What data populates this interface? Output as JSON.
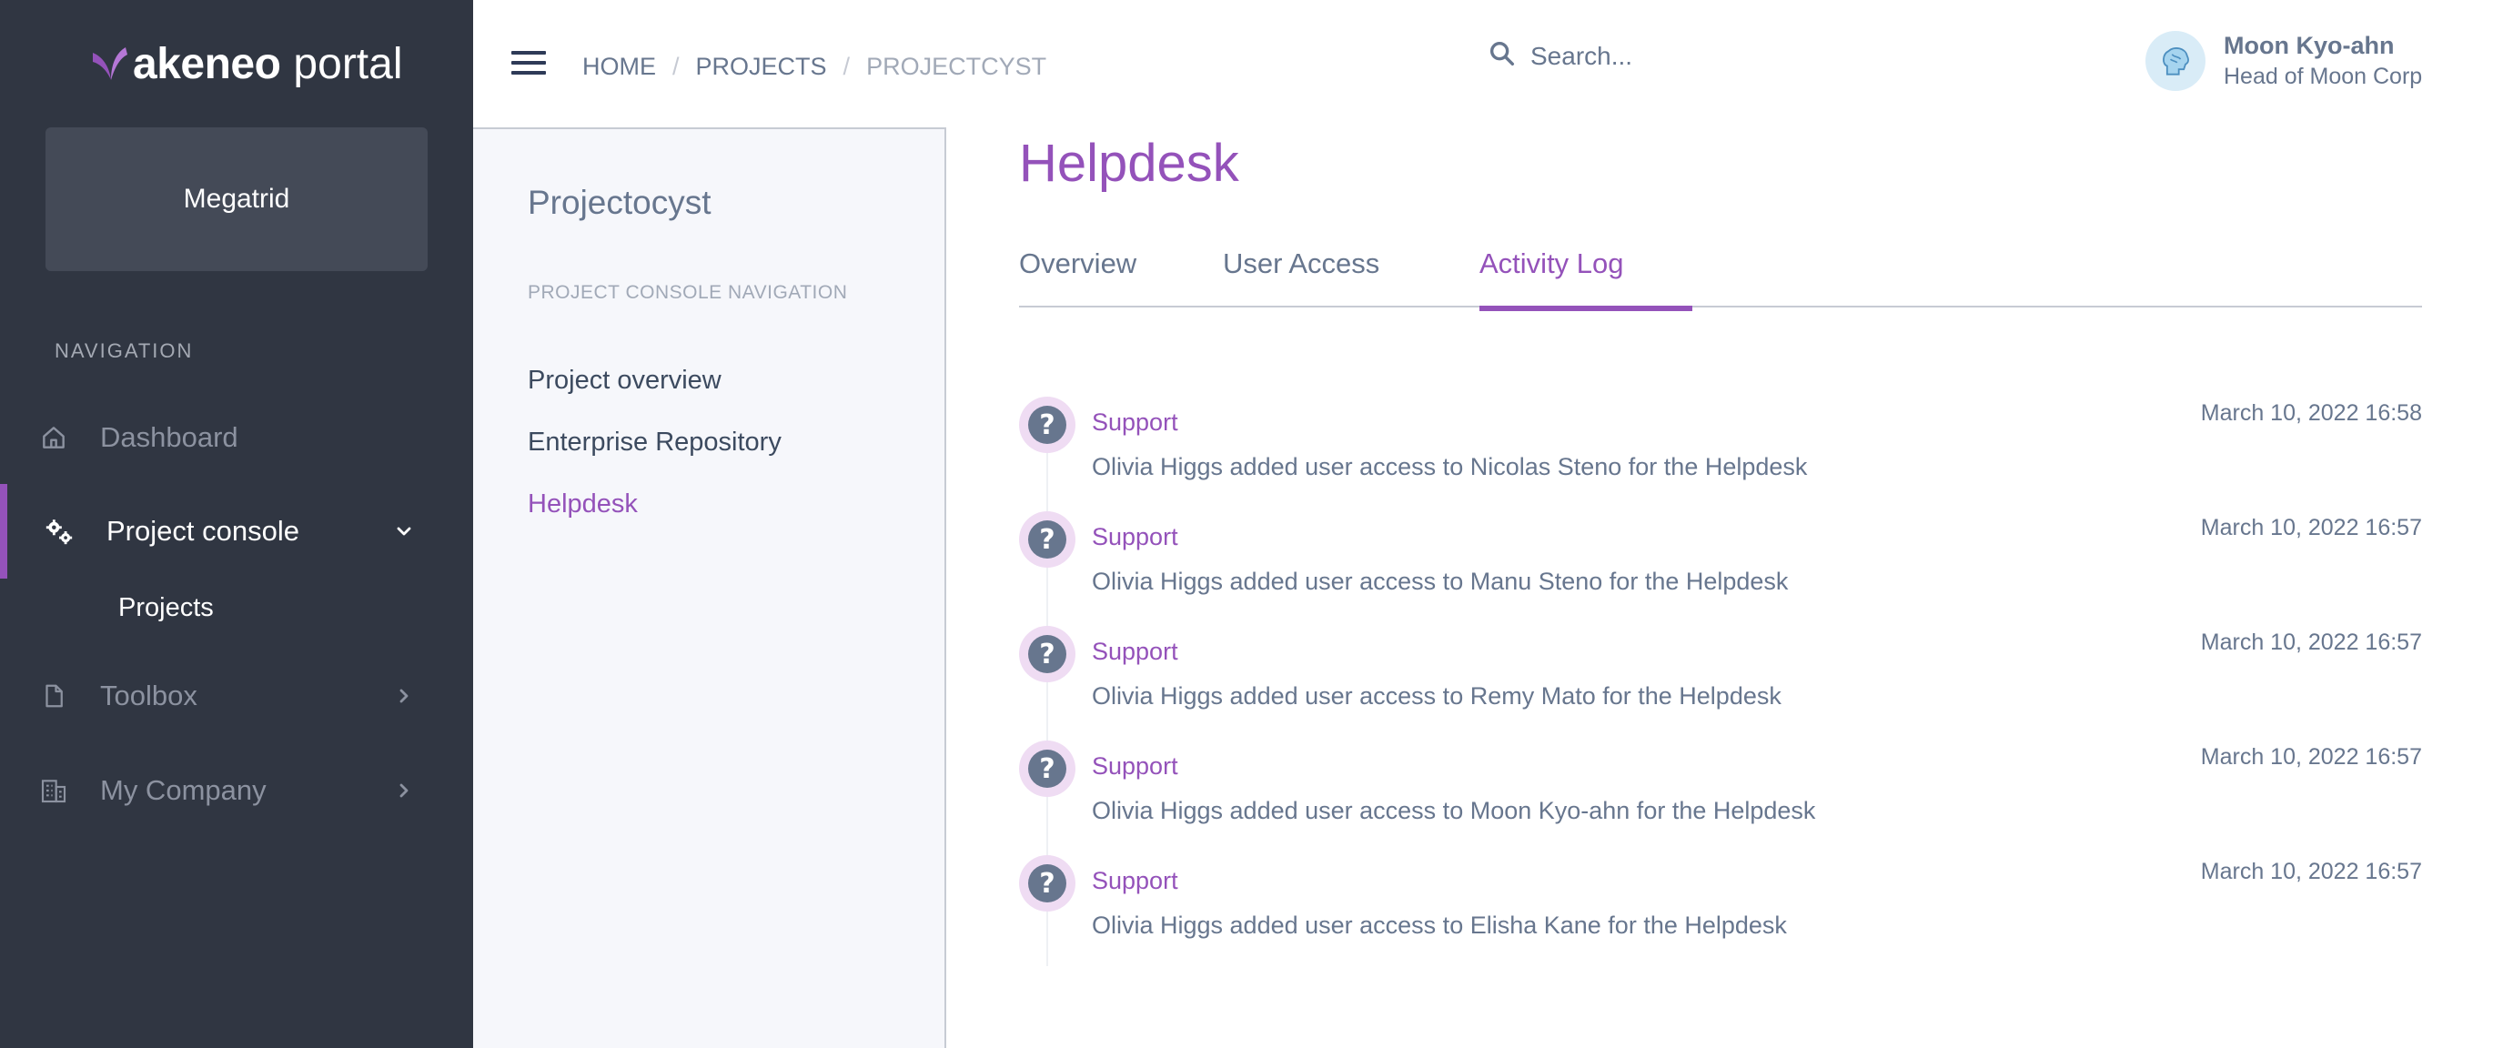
{
  "sidebar": {
    "logo": {
      "brand": "akeneo",
      "suffix": "portal"
    },
    "tenant": "Megatrid",
    "nav_heading": "NAVIGATION",
    "items": [
      {
        "label": "Dashboard",
        "icon": "home-icon"
      },
      {
        "label": "Project console",
        "icon": "gears-icon",
        "active": true,
        "expanded": true
      },
      {
        "label": "Toolbox",
        "icon": "file-icon"
      },
      {
        "label": "My Company",
        "icon": "building-icon"
      }
    ],
    "subitems": [
      {
        "label": "Projects"
      }
    ]
  },
  "header": {
    "breadcrumb": [
      "HOME",
      "PROJECTS",
      "PROJECTCYST"
    ],
    "search_placeholder": "Search...",
    "user": {
      "name": "Moon Kyo-ahn",
      "role": "Head of Moon Corp"
    }
  },
  "project_panel": {
    "title": "Projectocyst",
    "nav_heading": "PROJECT CONSOLE NAVIGATION",
    "links": [
      {
        "label": "Project overview"
      },
      {
        "label": "Enterprise Repository"
      },
      {
        "label": "Helpdesk",
        "active": true
      }
    ]
  },
  "main": {
    "title": "Helpdesk",
    "tabs": [
      {
        "label": "Overview"
      },
      {
        "label": "User Access"
      },
      {
        "label": "Activity Log",
        "active": true
      }
    ],
    "activity": [
      {
        "actor": "Support",
        "message": "Olivia Higgs added user access to Nicolas Steno for the Helpdesk",
        "time": "March 10, 2022 16:58"
      },
      {
        "actor": "Support",
        "message": "Olivia Higgs added user access to Manu Steno for the Helpdesk",
        "time": "March 10, 2022 16:57"
      },
      {
        "actor": "Support",
        "message": "Olivia Higgs added user access to Remy Mato for the Helpdesk",
        "time": "March 10, 2022 16:57"
      },
      {
        "actor": "Support",
        "message": "Olivia Higgs added user access to Moon Kyo-ahn for the Helpdesk",
        "time": "March 10, 2022 16:57"
      },
      {
        "actor": "Support",
        "message": "Olivia Higgs added user access to Elisha Kane for the Helpdesk",
        "time": "March 10, 2022 16:57"
      }
    ]
  },
  "colors": {
    "accent": "#9452ba",
    "sidebar_bg": "#303642",
    "text_muted": "#67768e"
  }
}
